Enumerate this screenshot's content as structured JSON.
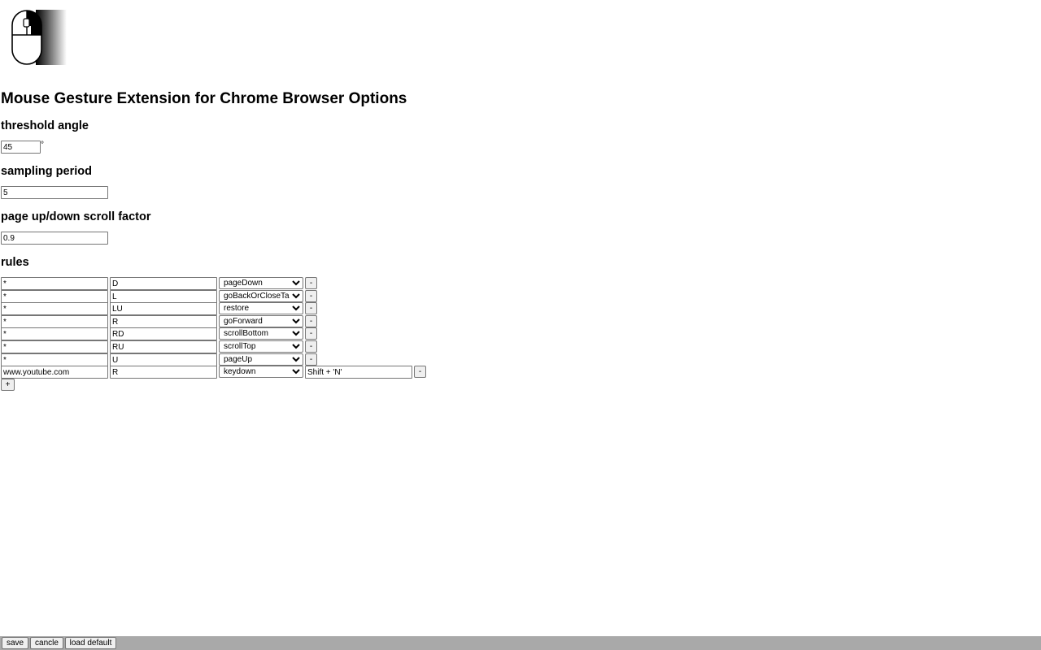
{
  "header": {
    "title": "Mouse Gesture Extension for Chrome Browser Options",
    "logo_icon": "computer-mouse-icon"
  },
  "threshold": {
    "label": "threshold angle",
    "value": "45",
    "unit": "°"
  },
  "sampling": {
    "label": "sampling period",
    "value": "5"
  },
  "scroll": {
    "label": "page up/down scroll factor",
    "value": "0.9"
  },
  "rules": {
    "label": "rules",
    "remove_label": "-",
    "add_label": "+",
    "action_options": [
      "pageDown",
      "goBackOrCloseTab",
      "restore",
      "goForward",
      "scrollBottom",
      "scrollTop",
      "pageUp",
      "keydown"
    ],
    "items": [
      {
        "pattern": "*",
        "gesture": "D",
        "action": "pageDown"
      },
      {
        "pattern": "*",
        "gesture": "L",
        "action": "goBackOrCloseTab"
      },
      {
        "pattern": "*",
        "gesture": "LU",
        "action": "restore"
      },
      {
        "pattern": "*",
        "gesture": "R",
        "action": "goForward"
      },
      {
        "pattern": "*",
        "gesture": "RD",
        "action": "scrollBottom"
      },
      {
        "pattern": "*",
        "gesture": "RU",
        "action": "scrollTop"
      },
      {
        "pattern": "*",
        "gesture": "U",
        "action": "pageUp"
      },
      {
        "pattern": "www.youtube.com",
        "gesture": "R",
        "action": "keydown",
        "param": "Shift + 'N'"
      }
    ]
  },
  "footer": {
    "save_label": "save",
    "cancel_label": "cancle",
    "load_default_label": "load default",
    "background": "#a9a9a9"
  }
}
